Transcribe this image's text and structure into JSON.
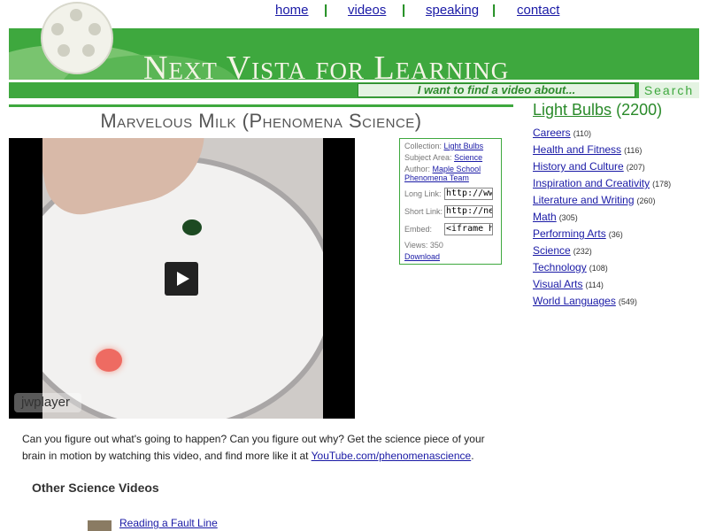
{
  "nav": {
    "home": "home",
    "videos": "videos",
    "speaking": "speaking",
    "contact": "contact",
    "separator": "|"
  },
  "header": {
    "site_title": "Next Vista for Learning"
  },
  "search": {
    "placeholder": "I want to find a video about...",
    "button": "Search"
  },
  "video": {
    "title": "Marvelous Milk (Phenomena Science)",
    "player_label": "jwplayer",
    "colors": {
      "accent_green": "#3ea83e",
      "link_blue": "#1a1aa6"
    }
  },
  "info": {
    "collection_label": "Collection:",
    "collection": "Light Bulbs",
    "subject_label": "Subject Area:",
    "subject": "Science",
    "author_label": "Author:",
    "author": "Maple School Phenomena Team",
    "long_link_label": "Long Link:",
    "long_link_value": "http://www.n",
    "short_link_label": "Short Link:",
    "short_link_value": "http://nextvi",
    "embed_label": "Embed:",
    "embed_value": "<iframe heig",
    "views": "Views: 350",
    "download": "Download"
  },
  "sidebar": {
    "heading": "Light Bulbs",
    "heading_count": "(2200)",
    "categories": [
      {
        "label": "Careers",
        "count": "(110)"
      },
      {
        "label": "Health and Fitness",
        "count": "(116)"
      },
      {
        "label": "History and Culture",
        "count": "(207)"
      },
      {
        "label": "Inspiration and Creativity",
        "count": "(178)"
      },
      {
        "label": "Literature and Writing",
        "count": "(260)"
      },
      {
        "label": "Math",
        "count": "(305)"
      },
      {
        "label": "Performing Arts",
        "count": "(36)"
      },
      {
        "label": "Science",
        "count": "(232)"
      },
      {
        "label": "Technology",
        "count": "(108)"
      },
      {
        "label": "Visual Arts",
        "count": "(114)"
      },
      {
        "label": "World Languages",
        "count": "(549)"
      }
    ]
  },
  "description": {
    "text": "Can you figure out what's going to happen? Can you figure out why? Get the science piece of your brain in motion by watching this video, and find more like it at ",
    "link": "YouTube.com/phenomenascience",
    "end": "."
  },
  "other": {
    "heading": "Other Science Videos",
    "items": [
      {
        "title": "Reading a Fault Line"
      }
    ]
  }
}
